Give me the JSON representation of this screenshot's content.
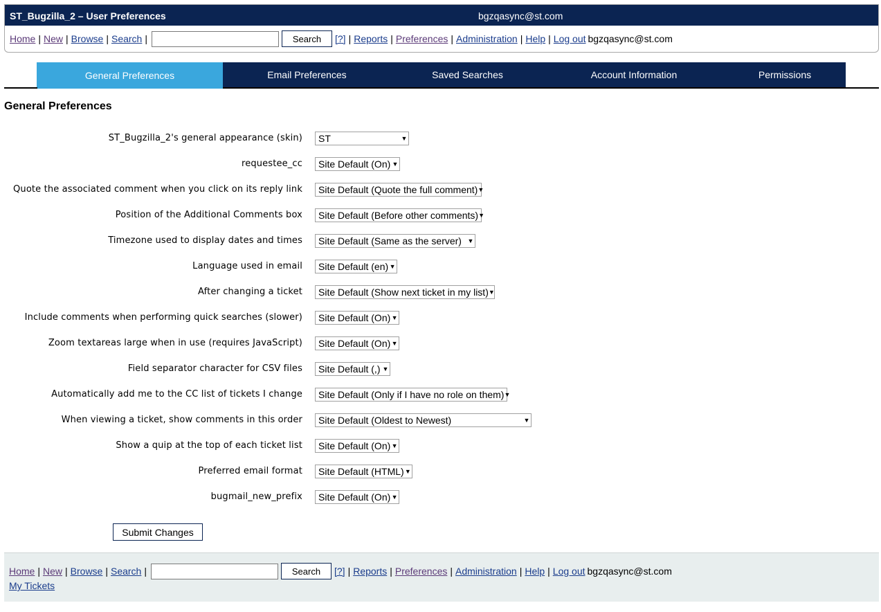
{
  "header": {
    "title": "ST_Bugzilla_2 – User Preferences",
    "user": "bgzqasync@st.com"
  },
  "nav": {
    "home": "Home",
    "new": "New",
    "browse": "Browse",
    "search": "Search",
    "search_button": "Search",
    "help_q": "[?]",
    "reports": "Reports",
    "preferences": "Preferences",
    "administration": "Administration",
    "help": "Help",
    "logout": "Log out",
    "user": "bgzqasync@st.com",
    "quicksearch_value": ""
  },
  "tabs": [
    {
      "label": "General Preferences",
      "active": true
    },
    {
      "label": "Email Preferences",
      "active": false
    },
    {
      "label": "Saved Searches",
      "active": false
    },
    {
      "label": "Account Information",
      "active": false
    },
    {
      "label": "Permissions",
      "active": false
    }
  ],
  "section_title": "General Preferences",
  "prefs": [
    {
      "label": "ST_Bugzilla_2's general appearance (skin)",
      "value": "ST"
    },
    {
      "label": "requestee_cc",
      "value": "Site Default (On)"
    },
    {
      "label": "Quote the associated comment when you click on its reply link",
      "value": "Site Default (Quote the full comment)"
    },
    {
      "label": "Position of the Additional Comments box",
      "value": "Site Default (Before other comments)"
    },
    {
      "label": "Timezone used to display dates and times",
      "value": "Site Default (Same as the server)"
    },
    {
      "label": "Language used in email",
      "value": "Site Default (en)"
    },
    {
      "label": "After changing a ticket",
      "value": "Site Default (Show next ticket in my list)"
    },
    {
      "label": "Include comments when performing quick searches (slower)",
      "value": "Site Default (On)"
    },
    {
      "label": "Zoom textareas large when in use (requires JavaScript)",
      "value": "Site Default (On)"
    },
    {
      "label": "Field separator character for CSV files",
      "value": "Site Default (,)"
    },
    {
      "label": "Automatically add me to the CC list of tickets I change",
      "value": "Site Default (Only if I have no role on them)"
    },
    {
      "label": "When viewing a ticket, show comments in this order",
      "value": "Site Default (Oldest to Newest)"
    },
    {
      "label": "Show a quip at the top of each ticket list",
      "value": "Site Default (On)"
    },
    {
      "label": "Preferred email format",
      "value": "Site Default (HTML)"
    },
    {
      "label": "bugmail_new_prefix",
      "value": "Site Default (On)"
    }
  ],
  "submit_label": "Submit Changes",
  "footer": {
    "my_tickets": "My Tickets"
  },
  "colors": {
    "header_bg": "#0b2452",
    "active_tab": "#3aa7dd",
    "footer_bg": "#e8eeee",
    "link": "#1a3c8c"
  }
}
